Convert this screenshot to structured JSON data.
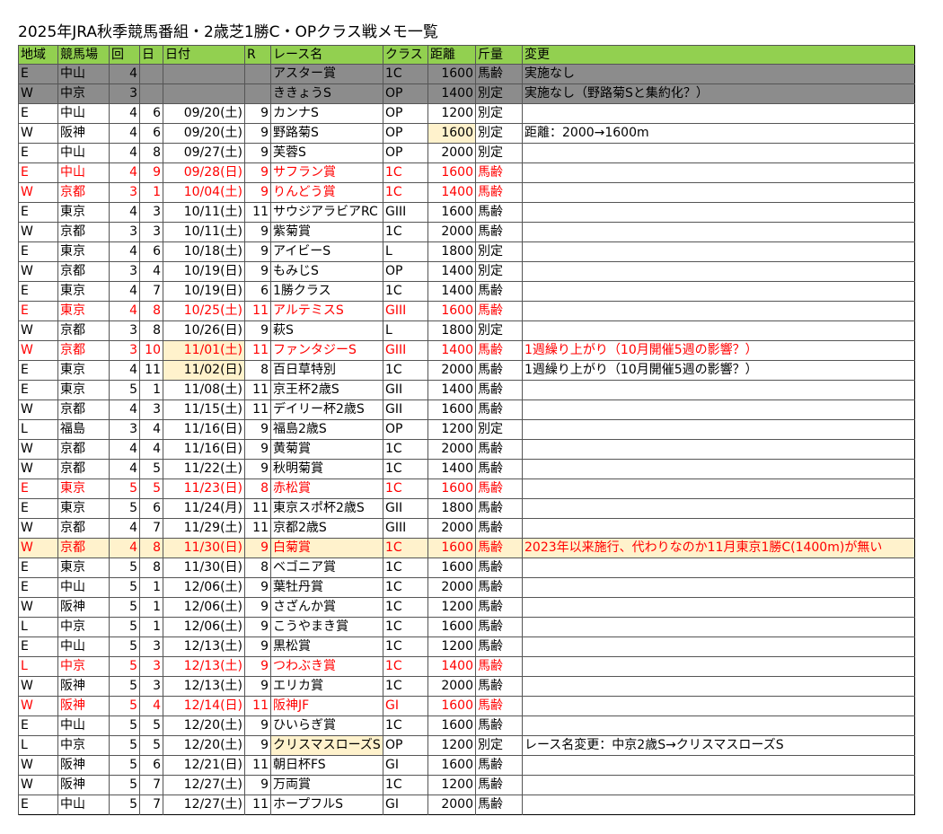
{
  "title": "2025年JRA秋季競馬番組・2歳芝1勝C・OPクラス戦メモ一覧",
  "columns": [
    "地域",
    "競馬場",
    "回",
    "日",
    "日付",
    "R",
    "レース名",
    "クラス",
    "距離",
    "斤量",
    "変更"
  ],
  "rows": [
    {
      "cells": [
        "E",
        "中山",
        "4",
        "",
        "",
        "",
        "アスター賞",
        "1C",
        "1600",
        "馬齢",
        "実施なし"
      ],
      "style": "gray"
    },
    {
      "cells": [
        "W",
        "中京",
        "3",
        "",
        "",
        "",
        "ききょうS",
        "OP",
        "1400",
        "別定",
        "実施なし（野路菊Sと集約化？）"
      ],
      "style": "gray"
    },
    {
      "cells": [
        "E",
        "中山",
        "4",
        "6",
        "09/20(土)",
        "9",
        "カンナS",
        "OP",
        "1200",
        "別定",
        ""
      ]
    },
    {
      "cells": [
        "W",
        "阪神",
        "4",
        "6",
        "09/20(土)",
        "9",
        "野路菊S",
        "OP",
        "1600",
        "別定",
        "距離：2000→1600m"
      ],
      "yellow_cells": [
        8
      ]
    },
    {
      "cells": [
        "E",
        "中山",
        "4",
        "8",
        "09/27(土)",
        "9",
        "芙蓉S",
        "OP",
        "2000",
        "別定",
        ""
      ]
    },
    {
      "cells": [
        "E",
        "中山",
        "4",
        "9",
        "09/28(日)",
        "9",
        "サフラン賞",
        "1C",
        "1600",
        "馬齢",
        ""
      ],
      "style": "red"
    },
    {
      "cells": [
        "W",
        "京都",
        "3",
        "1",
        "10/04(土)",
        "9",
        "りんどう賞",
        "1C",
        "1400",
        "馬齢",
        ""
      ],
      "style": "red"
    },
    {
      "cells": [
        "E",
        "東京",
        "4",
        "3",
        "10/11(土)",
        "11",
        "サウジアラビアRC",
        "GIII",
        "1600",
        "馬齢",
        ""
      ]
    },
    {
      "cells": [
        "W",
        "京都",
        "3",
        "3",
        "10/11(土)",
        "9",
        "紫菊賞",
        "1C",
        "2000",
        "馬齢",
        ""
      ]
    },
    {
      "cells": [
        "E",
        "東京",
        "4",
        "6",
        "10/18(土)",
        "9",
        "アイビーS",
        "L",
        "1800",
        "別定",
        ""
      ]
    },
    {
      "cells": [
        "W",
        "京都",
        "3",
        "4",
        "10/19(日)",
        "9",
        "もみじS",
        "OP",
        "1400",
        "別定",
        ""
      ]
    },
    {
      "cells": [
        "E",
        "東京",
        "4",
        "7",
        "10/19(日)",
        "6",
        "1勝クラス",
        "1C",
        "1400",
        "馬齢",
        ""
      ]
    },
    {
      "cells": [
        "E",
        "東京",
        "4",
        "8",
        "10/25(土)",
        "11",
        "アルテミスS",
        "GIII",
        "1600",
        "馬齢",
        ""
      ],
      "style": "red"
    },
    {
      "cells": [
        "W",
        "京都",
        "3",
        "8",
        "10/26(日)",
        "9",
        "萩S",
        "L",
        "1800",
        "別定",
        ""
      ]
    },
    {
      "cells": [
        "W",
        "京都",
        "3",
        "10",
        "11/01(土)",
        "11",
        "ファンタジーS",
        "GIII",
        "1400",
        "馬齢",
        "1週繰り上がり（10月開催5週の影響？）"
      ],
      "style": "red",
      "yellow_cells": [
        4
      ]
    },
    {
      "cells": [
        "E",
        "東京",
        "4",
        "11",
        "11/02(日)",
        "8",
        "百日草特別",
        "1C",
        "2000",
        "馬齢",
        "1週繰り上がり（10月開催5週の影響？）"
      ],
      "yellow_cells": [
        4
      ]
    },
    {
      "cells": [
        "E",
        "東京",
        "5",
        "1",
        "11/08(土)",
        "11",
        "京王杯2歳S",
        "GII",
        "1400",
        "馬齢",
        ""
      ]
    },
    {
      "cells": [
        "W",
        "京都",
        "4",
        "3",
        "11/15(土)",
        "11",
        "デイリー杯2歳S",
        "GII",
        "1600",
        "馬齢",
        ""
      ]
    },
    {
      "cells": [
        "L",
        "福島",
        "3",
        "4",
        "11/16(日)",
        "9",
        "福島2歳S",
        "OP",
        "1200",
        "別定",
        ""
      ]
    },
    {
      "cells": [
        "W",
        "京都",
        "4",
        "4",
        "11/16(日)",
        "9",
        "黄菊賞",
        "1C",
        "2000",
        "馬齢",
        ""
      ]
    },
    {
      "cells": [
        "W",
        "京都",
        "4",
        "5",
        "11/22(土)",
        "9",
        "秋明菊賞",
        "1C",
        "1400",
        "馬齢",
        ""
      ]
    },
    {
      "cells": [
        "E",
        "東京",
        "5",
        "5",
        "11/23(日)",
        "8",
        "赤松賞",
        "1C",
        "1600",
        "馬齢",
        ""
      ],
      "style": "red"
    },
    {
      "cells": [
        "E",
        "東京",
        "5",
        "6",
        "11/24(月)",
        "11",
        "東京スポ杯2歳S",
        "GII",
        "1800",
        "馬齢",
        ""
      ]
    },
    {
      "cells": [
        "W",
        "京都",
        "4",
        "7",
        "11/29(土)",
        "11",
        "京都2歳S",
        "GIII",
        "2000",
        "馬齢",
        ""
      ]
    },
    {
      "cells": [
        "W",
        "京都",
        "4",
        "8",
        "11/30(日)",
        "9",
        "白菊賞",
        "1C",
        "1600",
        "馬齢",
        "2023年以来施行、代わりなのか11月東京1勝C(1400m)が無い"
      ],
      "style": "red hl"
    },
    {
      "cells": [
        "E",
        "東京",
        "5",
        "8",
        "11/30(日)",
        "8",
        "ベゴニア賞",
        "1C",
        "1600",
        "馬齢",
        ""
      ]
    },
    {
      "cells": [
        "E",
        "中山",
        "5",
        "1",
        "12/06(土)",
        "9",
        "葉牡丹賞",
        "1C",
        "2000",
        "馬齢",
        ""
      ]
    },
    {
      "cells": [
        "W",
        "阪神",
        "5",
        "1",
        "12/06(土)",
        "9",
        "さざんか賞",
        "1C",
        "1200",
        "馬齢",
        ""
      ]
    },
    {
      "cells": [
        "L",
        "中京",
        "5",
        "1",
        "12/06(土)",
        "9",
        "こうやまき賞",
        "1C",
        "1600",
        "馬齢",
        ""
      ]
    },
    {
      "cells": [
        "E",
        "中山",
        "5",
        "3",
        "12/13(土)",
        "9",
        "黒松賞",
        "1C",
        "1200",
        "馬齢",
        ""
      ]
    },
    {
      "cells": [
        "L",
        "中京",
        "5",
        "3",
        "12/13(土)",
        "9",
        "つわぶき賞",
        "1C",
        "1400",
        "馬齢",
        ""
      ],
      "style": "red"
    },
    {
      "cells": [
        "W",
        "阪神",
        "5",
        "3",
        "12/13(土)",
        "9",
        "エリカ賞",
        "1C",
        "2000",
        "馬齢",
        ""
      ]
    },
    {
      "cells": [
        "W",
        "阪神",
        "5",
        "4",
        "12/14(日)",
        "11",
        "阪神JF",
        "GI",
        "1600",
        "馬齢",
        ""
      ],
      "style": "red"
    },
    {
      "cells": [
        "E",
        "中山",
        "5",
        "5",
        "12/20(土)",
        "9",
        "ひいらぎ賞",
        "1C",
        "1600",
        "馬齢",
        ""
      ]
    },
    {
      "cells": [
        "L",
        "中京",
        "5",
        "5",
        "12/20(土)",
        "9",
        "クリスマスローズS",
        "OP",
        "1200",
        "別定",
        "レース名変更：中京2歳S→クリスマスローズS"
      ],
      "yellow_cells": [
        6
      ]
    },
    {
      "cells": [
        "W",
        "阪神",
        "5",
        "6",
        "12/21(日)",
        "11",
        "朝日杯FS",
        "GI",
        "1600",
        "馬齢",
        ""
      ]
    },
    {
      "cells": [
        "W",
        "阪神",
        "5",
        "7",
        "12/27(土)",
        "9",
        "万両賞",
        "1C",
        "1200",
        "馬齢",
        ""
      ]
    },
    {
      "cells": [
        "E",
        "中山",
        "5",
        "7",
        "12/27(土)",
        "11",
        "ホープフルS",
        "GI",
        "2000",
        "馬齢",
        ""
      ]
    }
  ]
}
